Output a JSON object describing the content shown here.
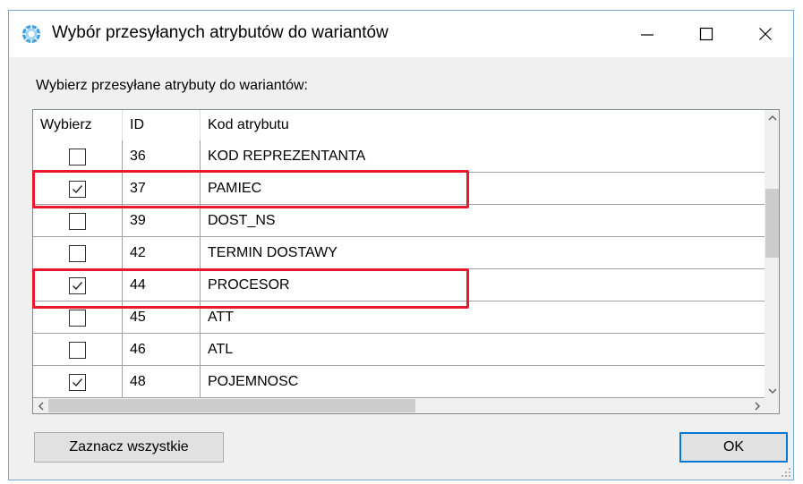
{
  "window": {
    "title": "Wybór przesyłanych atrybutów do wariantów",
    "controls": [
      "minimize",
      "maximize",
      "close"
    ]
  },
  "instruction": "Wybierz przesyłane atrybuty do wariantów:",
  "grid": {
    "columns": [
      "Wybierz",
      "ID",
      "Kod atrybutu"
    ],
    "rows": [
      {
        "checked": false,
        "id": "36",
        "code": "KOD REPREZENTANTA"
      },
      {
        "checked": true,
        "id": "37",
        "code": "PAMIEC",
        "highlighted": true
      },
      {
        "checked": false,
        "id": "39",
        "code": "DOST_NS"
      },
      {
        "checked": false,
        "id": "42",
        "code": "TERMIN DOSTAWY"
      },
      {
        "checked": true,
        "id": "44",
        "code": "PROCESOR",
        "highlighted": true
      },
      {
        "checked": false,
        "id": "45",
        "code": "ATT"
      },
      {
        "checked": false,
        "id": "46",
        "code": "ATL"
      },
      {
        "checked": true,
        "id": "48",
        "code": "POJEMNOSC"
      }
    ]
  },
  "buttons": {
    "select_all": "Zaznacz wszystkie",
    "ok": "OK"
  },
  "colors": {
    "highlight": "#e8192c",
    "default_button_border": "#0078d7"
  }
}
